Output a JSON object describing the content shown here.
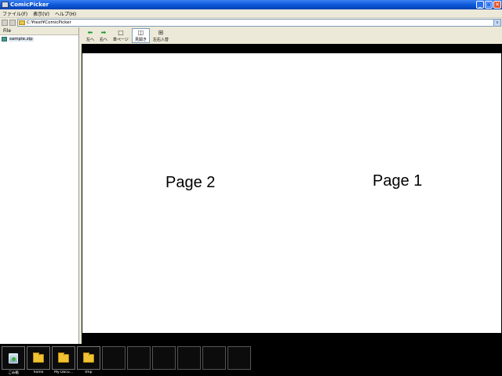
{
  "window": {
    "title": "ComicPicker",
    "minimize": "_",
    "maximize": "□",
    "close": "✕"
  },
  "menu": [
    "ファイル(F)",
    "表示(V)",
    "ヘルプ(H)"
  ],
  "address": {
    "path": "C:¥test¥ComicPicker",
    "dropdown": "∨"
  },
  "sidebar": {
    "header": "File",
    "items": [
      {
        "label": "sample.zip"
      }
    ]
  },
  "toolbar": [
    {
      "label": "左へ",
      "icon": "left-arrow-icon",
      "glyph": "⬅",
      "active": false
    },
    {
      "label": "右へ",
      "icon": "right-arrow-icon",
      "glyph": "➡",
      "active": false
    },
    {
      "label": "単ページ",
      "icon": "single-page-icon",
      "glyph": "□",
      "active": false
    },
    {
      "label": "見開き",
      "icon": "spread-icon",
      "glyph": "◫",
      "active": true
    },
    {
      "label": "左右入替",
      "icon": "swap-icon",
      "glyph": "⊞",
      "active": false
    }
  ],
  "viewer": {
    "left_page": "Page 2",
    "right_page": "Page 1"
  },
  "taskbar": [
    {
      "label": "ごみ箱",
      "icon": "recycle-bin-icon"
    },
    {
      "label": "home",
      "icon": "folder-icon"
    },
    {
      "label": "My Docu...",
      "icon": "folder-icon"
    },
    {
      "label": "tmp",
      "icon": "folder-icon"
    },
    {
      "label": "",
      "icon": ""
    },
    {
      "label": "",
      "icon": ""
    },
    {
      "label": "",
      "icon": ""
    },
    {
      "label": "",
      "icon": ""
    },
    {
      "label": "",
      "icon": ""
    },
    {
      "label": "",
      "icon": ""
    }
  ]
}
